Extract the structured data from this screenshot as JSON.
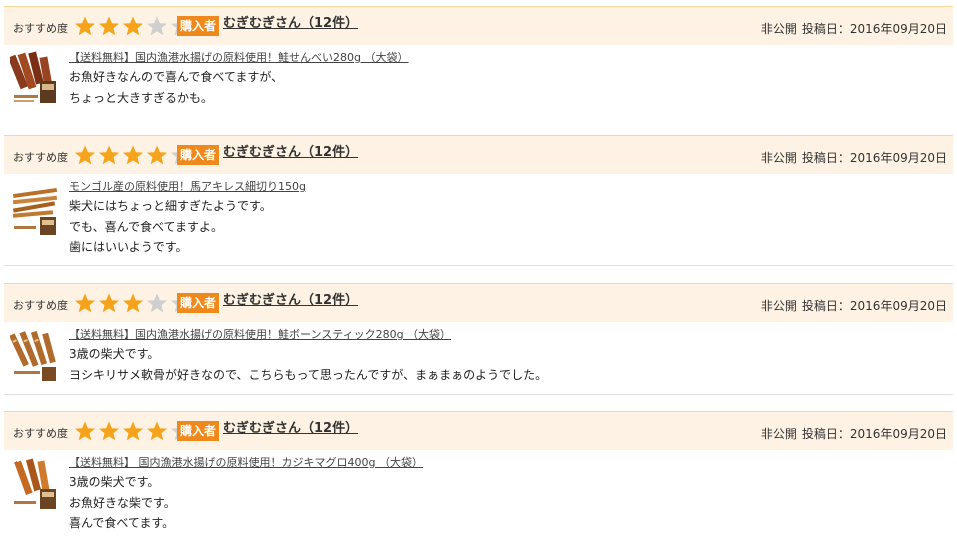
{
  "colors": {
    "header_bg": "#fdf2e3",
    "header_border": "#f3d89a",
    "star_filled": "#f5a31b",
    "star_empty": "#cfcfcf",
    "buyer_badge": "#f0891b"
  },
  "reviews": [
    {
      "rating_label": "おすすめ度",
      "stars": 3,
      "max_stars": 5,
      "buyer_badge": "購入者",
      "reviewer": "むぎむぎさん（12件）",
      "visibility": "非公開",
      "posted": "投稿日：2016年09月20日",
      "product": "【送料無料】国内漁港水揚げの原料使用！鮭せんべい280g （大袋）",
      "comment": [
        "お魚好きなんので喜んで食べてますが、",
        "ちょっと大きすぎるかも。"
      ]
    },
    {
      "rating_label": "おすすめ度",
      "stars": 4,
      "max_stars": 5,
      "buyer_badge": "購入者",
      "reviewer": "むぎむぎさん（12件）",
      "visibility": "非公開",
      "posted": "投稿日：2016年09月20日",
      "product": "モンゴル産の原料使用！馬アキレス細切り150g",
      "comment": [
        "柴犬にはちょっと細すぎたようです。",
        "でも、喜んで食べてますよ。",
        "歯にはいいようです。"
      ]
    },
    {
      "rating_label": "おすすめ度",
      "stars": 3,
      "max_stars": 5,
      "buyer_badge": "購入者",
      "reviewer": "むぎむぎさん（12件）",
      "visibility": "非公開",
      "posted": "投稿日：2016年09月20日",
      "product": "【送料無料】国内漁港水揚げの原料使用！鮭ボーンスティック280g （大袋）",
      "comment": [
        "3歳の柴犬です。",
        "ヨシキリサメ軟骨が好きなので、こちらもって思ったんですが、まぁまぁのようでした。"
      ]
    },
    {
      "rating_label": "おすすめ度",
      "stars": 4,
      "max_stars": 5,
      "buyer_badge": "購入者",
      "reviewer": "むぎむぎさん（12件）",
      "visibility": "非公開",
      "posted": "投稿日：2016年09月20日",
      "product": "【送料無料】 国内漁港水揚げの原料使用！カジキマグロ400g （大袋）",
      "comment": [
        "3歳の柴犬です。",
        "お魚好きな柴です。",
        "喜んで食べてます。"
      ]
    }
  ]
}
